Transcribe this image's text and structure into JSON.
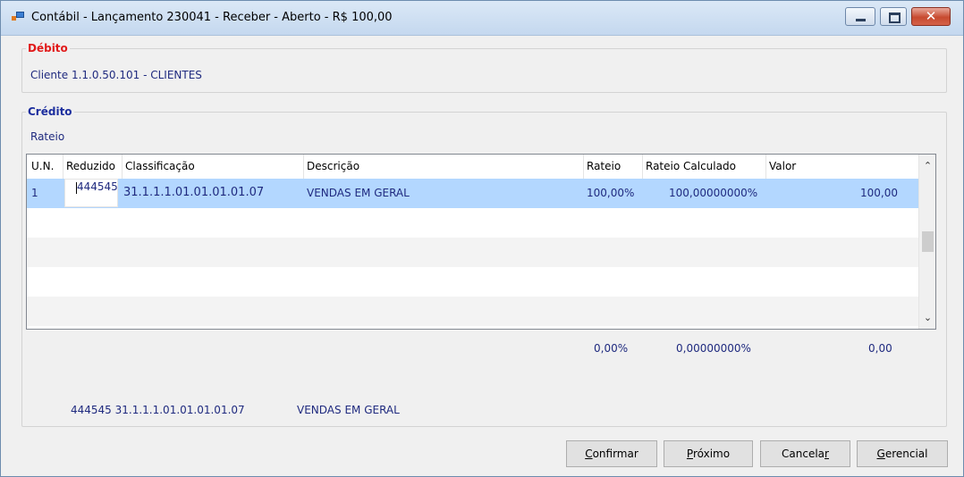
{
  "window": {
    "title": "Contábil - Lançamento 230041 - Receber - Aberto - R$ 100,00",
    "close_glyph": "✕"
  },
  "debito": {
    "legend": "Débito",
    "text": "Cliente 1.1.0.50.101 - CLIENTES"
  },
  "credito": {
    "legend": "Crédito",
    "mode_label": "Rateio",
    "grid": {
      "columns": [
        "U.N.",
        "Reduzido",
        "Classificação",
        "Descrição",
        "Rateio",
        "Rateio Calculado",
        "Valor"
      ],
      "rows": [
        {
          "un": "1",
          "reduzido": "444545",
          "classificacao": "31.1.1.1.01.01.01.01.07",
          "descricao": "VENDAS EM GERAL",
          "rateio": "100,00%",
          "rateio_calculado": "100,00000000%",
          "valor": "100,00"
        }
      ],
      "scroll_up": "⌃",
      "scroll_down": "⌄"
    },
    "totals": {
      "rateio": "0,00%",
      "rateio_calculado": "0,00000000%",
      "valor": "0,00"
    },
    "footer": {
      "code": "444545 31.1.1.1.01.01.01.01.07",
      "description": "VENDAS EM GERAL"
    }
  },
  "buttons": {
    "confirmar": {
      "hot": "C",
      "rest": "onfirmar"
    },
    "proximo": {
      "hot": "P",
      "rest": "róximo"
    },
    "cancelar": {
      "start": "Cancela",
      "hot": "r"
    },
    "gerencial": {
      "hot": "G",
      "rest": "erencial"
    }
  }
}
